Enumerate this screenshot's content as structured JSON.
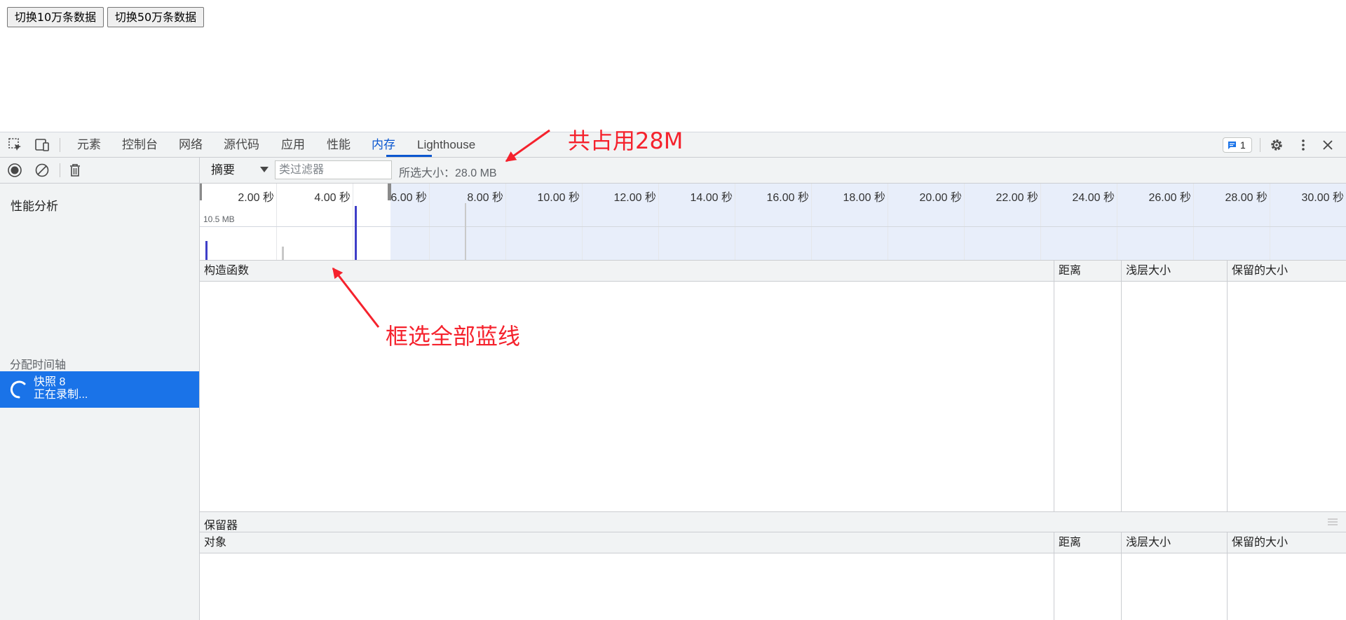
{
  "page_buttons": [
    "切换10万条数据",
    "切换50万条数据"
  ],
  "devtools": {
    "tabs": [
      "元素",
      "控制台",
      "网络",
      "源代码",
      "应用",
      "性能",
      "内存",
      "Lighthouse"
    ],
    "active_tab": "内存",
    "issues_count": "1",
    "accent_color": "#0b57d0"
  },
  "sidebar": {
    "profiles_heading": "性能分析",
    "group_label": "分配时间轴",
    "snapshot_title": "快照 8",
    "snapshot_status": "正在录制..."
  },
  "toolbar": {
    "view_select": "摘要",
    "class_filter_placeholder": "类过滤器",
    "selected_size": "所选大小：28.0 MB"
  },
  "timeline": {
    "ticks": [
      "2.00 秒",
      "4.00 秒",
      "6.00 秒",
      "8.00 秒",
      "10.00 秒",
      "12.00 秒",
      "14.00 秒",
      "16.00 秒",
      "18.00 秒",
      "20.00 秒",
      "22.00 秒",
      "24.00 秒",
      "26.00 秒",
      "28.00 秒",
      "30.00 秒"
    ],
    "max_label": "10.5 MB",
    "bars": [
      {
        "t": 0.15,
        "level": 0.36,
        "color": "#3f3fc8"
      },
      {
        "t": 2.15,
        "level": 0.26,
        "color": "#c8c8c8"
      },
      {
        "t": 4.05,
        "level": 1.0,
        "color": "#3f3fc8"
      }
    ]
  },
  "constructor_table": {
    "columns": [
      "构造函数",
      "距离",
      "浅层大小",
      "保留的大小"
    ]
  },
  "retainers": {
    "title": "保留器",
    "columns": [
      "对象",
      "距离",
      "浅层大小",
      "保留的大小"
    ]
  },
  "annotations": {
    "total": "共占用28M",
    "select": "框选全部蓝线"
  }
}
